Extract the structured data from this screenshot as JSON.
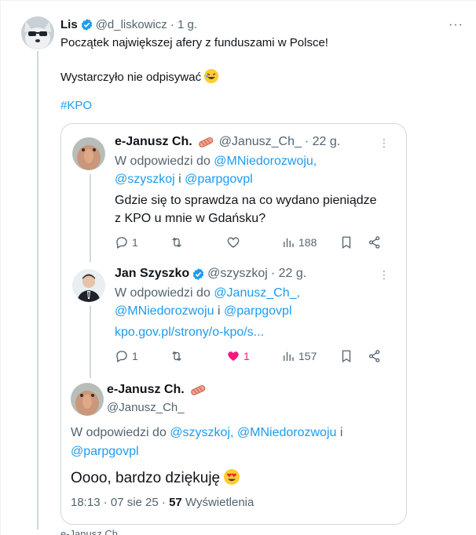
{
  "post": {
    "author_name": "Lis",
    "author_handle": "@d_liskowicz",
    "time": "· 1 g.",
    "more_label": "···",
    "line1": "Początek największej afery z funduszami w Polsce!",
    "line2": "Wystarczyło nie odpisywać",
    "hashtag": "#KPO"
  },
  "quote": {
    "tweet1": {
      "author_name": "e-Janusz Ch.",
      "author_handle": "@Janusz_Ch_",
      "time": "· 22 g.",
      "reply_prefix": "W odpowiedzi do",
      "reply_to_1": "@MNiedorozwoju,",
      "reply_to_2": "@szyszkoj",
      "reply_and": "i",
      "reply_to_3": "@parpgovpl",
      "text_line1": "Gdzie się to sprawdza na co wydano pieniądze",
      "text_line2": "z KPO u mnie w Gdańsku?",
      "replies": "1",
      "views": "188"
    },
    "tweet2": {
      "author_name": "Jan Szyszko",
      "author_handle": "@szyszkoj",
      "time": "· 22 g.",
      "reply_prefix": "W odpowiedzi do",
      "reply_to_1": "@Janusz_Ch_,",
      "reply_to_2": "@MNiedorozwoju",
      "reply_and": "i",
      "reply_to_3": "@parpgovpl",
      "link": "kpo.gov.pl/strony/o-kpo/s...",
      "replies": "1",
      "likes": "1",
      "views": "157"
    },
    "focused": {
      "author_name": "e-Janusz Ch.",
      "author_handle": "@Janusz_Ch_",
      "reply_prefix": "W odpowiedzi do",
      "reply_to_1": "@szyszkoj,",
      "reply_to_2": "@MNiedorozwoju",
      "reply_and": "i",
      "reply_to_3": "@parpgovpl",
      "text": "Oooo, bardzo dziękuję",
      "time": "18:13 · 07 sie 25 ·",
      "views_count": "57",
      "views_label": "Wyświetlenia"
    }
  },
  "footer_peek": "e-Janusz Ch.",
  "colors": {
    "accent": "#1d9bf0",
    "like": "#f91880",
    "secondary_text": "#536471"
  }
}
